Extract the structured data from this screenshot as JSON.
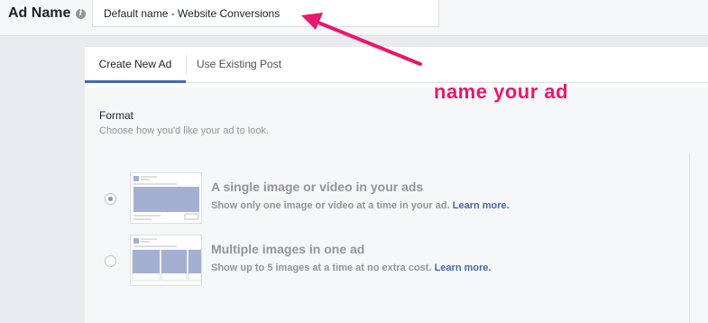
{
  "ad_name": {
    "label": "Ad Name",
    "info_icon": "info-icon",
    "value": "Default name - Website Conversions"
  },
  "tabs": [
    {
      "label": "Create New Ad",
      "active": true
    },
    {
      "label": "Use Existing Post",
      "active": false
    }
  ],
  "format": {
    "title": "Format",
    "subtitle": "Choose how you'd like your ad to look.",
    "options": [
      {
        "title": "A single image or video in your ads",
        "description": "Show only one image or video at a time in your ad.",
        "link": "Learn more.",
        "selected": true,
        "thumb_icon": "single-image-ad-icon"
      },
      {
        "title": "Multiple images in one ad",
        "description": "Show up to 5 images at a time at no extra cost.",
        "link": "Learn more.",
        "selected": false,
        "thumb_icon": "carousel-ad-icon"
      }
    ]
  },
  "annotation": {
    "text": "name your ad",
    "color": "#e8186d"
  },
  "colors": {
    "accent": "#4267b2",
    "thumb_fill": "#a4b0d2",
    "muted_text": "#90949c"
  }
}
